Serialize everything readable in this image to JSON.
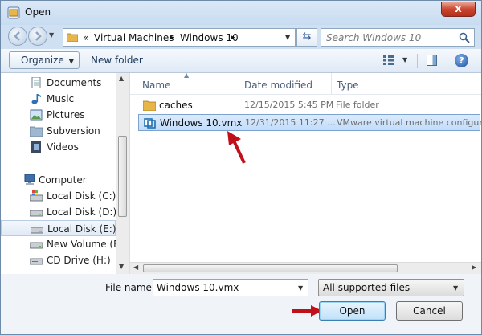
{
  "window": {
    "title": "Open",
    "close_label": "x"
  },
  "addressbar": {
    "overflow": "«",
    "crumbs": [
      "Virtual Machines",
      "Windows 10"
    ],
    "separator": "▸"
  },
  "search": {
    "placeholder": "Search Windows 10"
  },
  "toolbar": {
    "organize_label": "Organize",
    "new_folder_label": "New folder",
    "help_label": "?"
  },
  "navpane": {
    "favorites": [
      {
        "label": "Documents",
        "icon": "documents-icon"
      },
      {
        "label": "Music",
        "icon": "music-icon"
      },
      {
        "label": "Pictures",
        "icon": "pictures-icon"
      },
      {
        "label": "Subversion",
        "icon": "subversion-icon"
      },
      {
        "label": "Videos",
        "icon": "videos-icon"
      }
    ],
    "computer": {
      "label": "Computer",
      "icon": "computer-icon"
    },
    "drives": [
      {
        "label": "Local Disk (C:)",
        "icon": "windows-drive-icon"
      },
      {
        "label": "Local Disk (D:)",
        "icon": "drive-icon"
      },
      {
        "label": "Local Disk (E:)",
        "icon": "drive-icon",
        "selected": true
      },
      {
        "label": "New Volume (F:)",
        "icon": "drive-icon"
      },
      {
        "label": "CD Drive (H:)",
        "icon": "cd-drive-icon"
      }
    ]
  },
  "columns": {
    "name": "Name",
    "date": "Date modified",
    "type": "Type"
  },
  "files": [
    {
      "name": "caches",
      "date": "12/15/2015 5:45 PM",
      "type": "File folder",
      "icon": "folder-icon"
    },
    {
      "name": "Windows 10.vmx",
      "date": "12/31/2015 11:27 ...",
      "type": "VMware virtual machine configura",
      "icon": "vmx-file-icon",
      "selected": true
    }
  ],
  "bottom": {
    "file_name_label": "File name:",
    "file_name_value": "Windows 10.vmx",
    "filter_value": "All supported files",
    "open_label": "Open",
    "cancel_label": "Cancel"
  },
  "colors": {
    "accent": "#3c7fb1",
    "arrow": "#c0101a",
    "selection": "#c1dcfb"
  }
}
